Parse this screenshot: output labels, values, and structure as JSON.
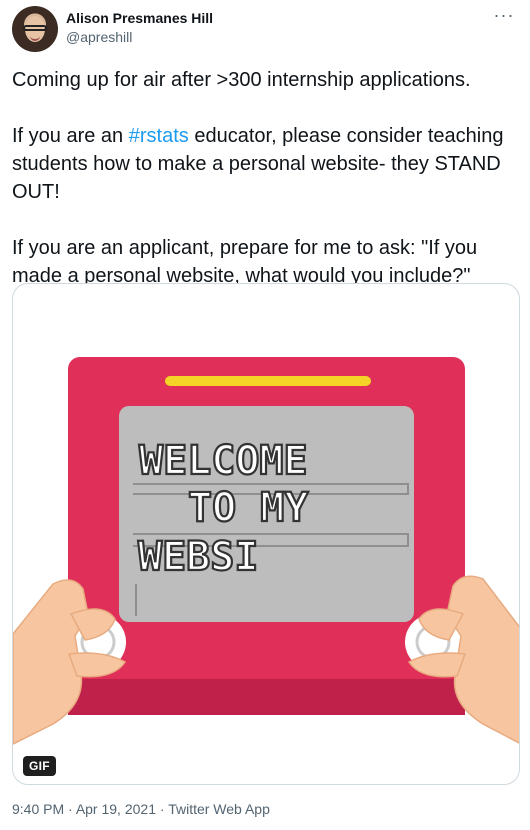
{
  "author": {
    "name": "Alison Presmanes Hill",
    "handle": "@apreshill"
  },
  "menu": {
    "icon": "more-horizontal-icon"
  },
  "tweet": {
    "line1": "Coming up for air after >300 internship applications.",
    "line2_before": "If you are an ",
    "hashtag": "#rstats",
    "line2_after": " educator, please consider teaching students how to make a personal website- they STAND OUT!",
    "line3": "If you are an applicant, prepare for me to ask: \"If you made a personal website, what would you include?\""
  },
  "media": {
    "screen_text": [
      "WELCOME",
      "TO MY",
      "WEBSI"
    ],
    "badge": "GIF",
    "colors": {
      "frame": "#e0305a",
      "screen": "#bdbdbd",
      "hands": "#f7c6a0",
      "bar": "#f5d327"
    }
  },
  "meta": {
    "time": "9:40 PM",
    "sep1": " · ",
    "date": "Apr 19, 2021",
    "sep2": " · ",
    "source": "Twitter Web App"
  }
}
